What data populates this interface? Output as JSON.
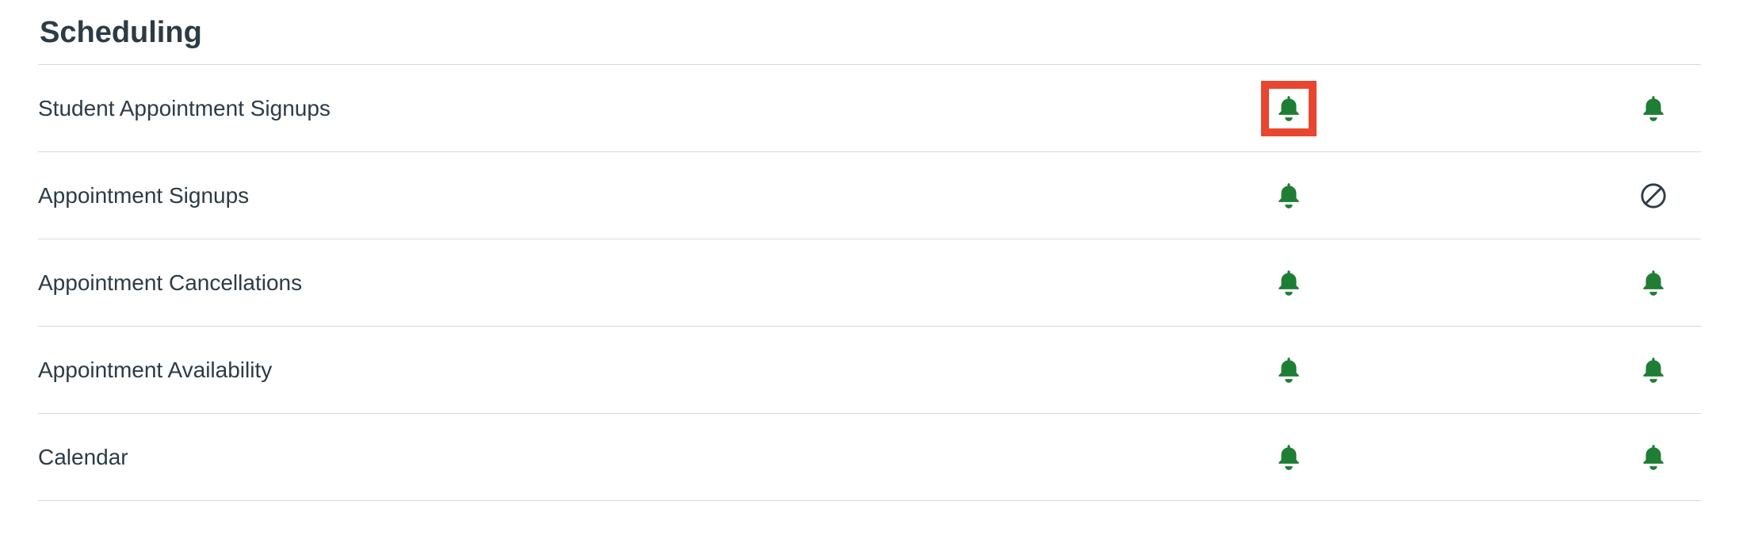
{
  "section": {
    "title": "Scheduling"
  },
  "colors": {
    "bell": "#1e7e34",
    "off": "#2d3b45",
    "highlight_border": "#e9462f"
  },
  "rows": [
    {
      "label": "Student Appointment Signups",
      "col1": "bell",
      "col1_highlight": true,
      "col2": "bell"
    },
    {
      "label": "Appointment Signups",
      "col1": "bell",
      "col1_highlight": false,
      "col2": "off"
    },
    {
      "label": "Appointment Cancellations",
      "col1": "bell",
      "col1_highlight": false,
      "col2": "bell"
    },
    {
      "label": "Appointment Availability",
      "col1": "bell",
      "col1_highlight": false,
      "col2": "bell"
    },
    {
      "label": "Calendar",
      "col1": "bell",
      "col1_highlight": false,
      "col2": "bell"
    }
  ]
}
